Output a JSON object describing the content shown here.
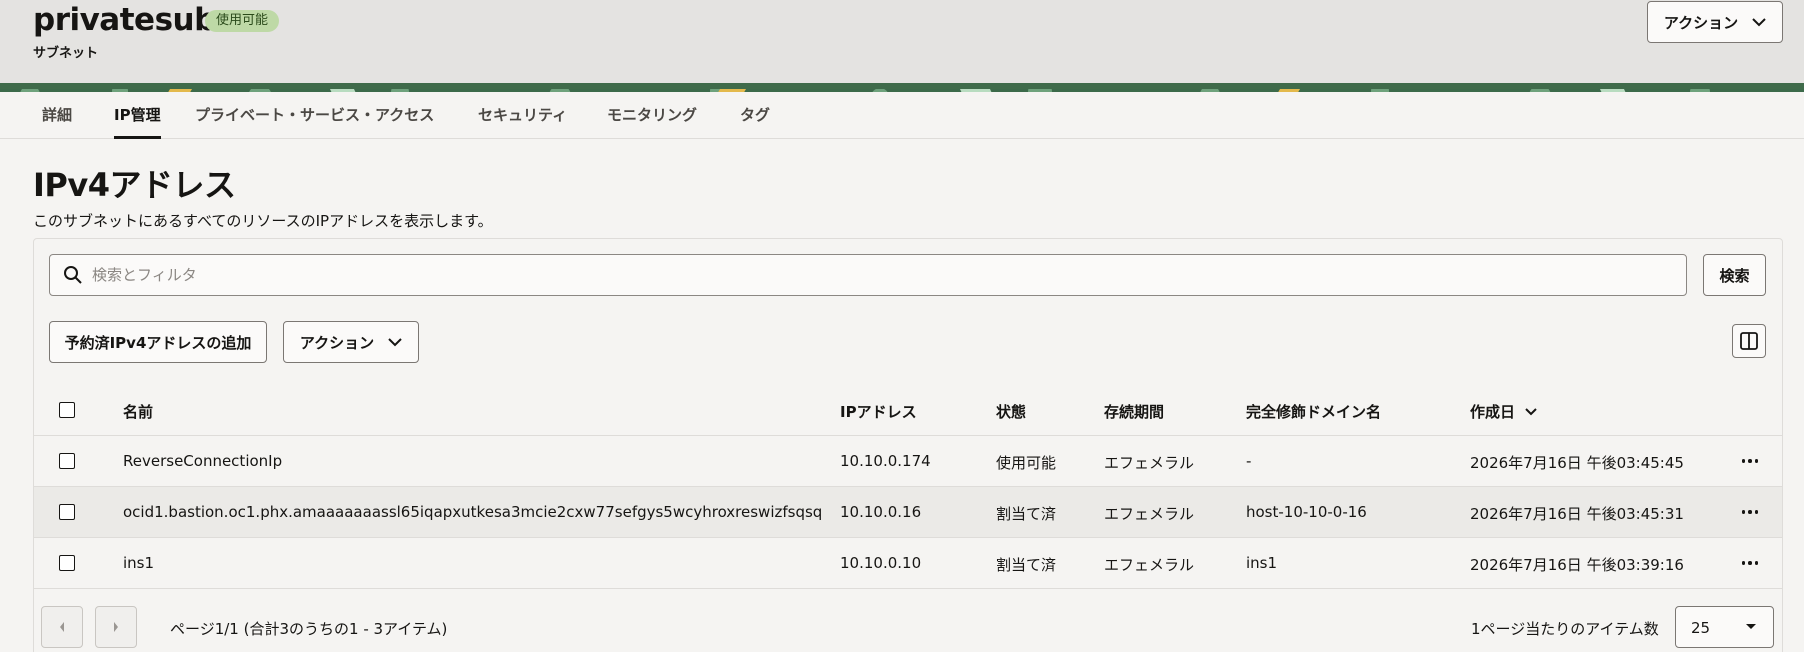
{
  "header": {
    "title": "privatesub",
    "status": "使用可能",
    "subtitle": "サブネット",
    "actions_label": "アクション"
  },
  "tabs": [
    "詳細",
    "IP管理",
    "プライベート・サービス・アクセス",
    "セキュリティ",
    "モニタリング",
    "タグ"
  ],
  "active_tab": "IP管理",
  "section": {
    "title": "IPv4アドレス",
    "description": "このサブネットにあるすべてのリソースのIPアドレスを表示します。"
  },
  "search": {
    "placeholder": "検索とフィルタ",
    "value": "",
    "button_label": "検索"
  },
  "toolbar": {
    "add_label": "予約済IPv4アドレスの追加",
    "actions_label": "アクション"
  },
  "table": {
    "columns": [
      "名前",
      "IPアドレス",
      "状態",
      "存続期間",
      "完全修飾ドメイン名",
      "作成日"
    ],
    "sort_column": "作成日",
    "rows": [
      [
        "ReverseConnectionIp",
        "10.10.0.174",
        "使用可能",
        "エフェメラル",
        "-",
        "2026年7月16日 午後03:45:45"
      ],
      [
        "ocid1.bastion.oc1.phx.amaaaaaaassl65iqapxutkesa3mcie2cxw77sefgys5wcyhroxreswizfsqsq",
        "10.10.0.16",
        "割当て済",
        "エフェメラル",
        "host-10-10-0-16",
        "2026年7月16日 午後03:45:31"
      ],
      [
        "ins1",
        "10.10.0.10",
        "割当て済",
        "エフェメラル",
        "ins1",
        "2026年7月16日 午後03:39:16"
      ]
    ]
  },
  "pagination": {
    "summary": "ページ1/1 (合計3のうちの1 - 3アイテム)",
    "per_page_label": "1ページ当たりのアイテム数",
    "per_page_value": "25"
  }
}
